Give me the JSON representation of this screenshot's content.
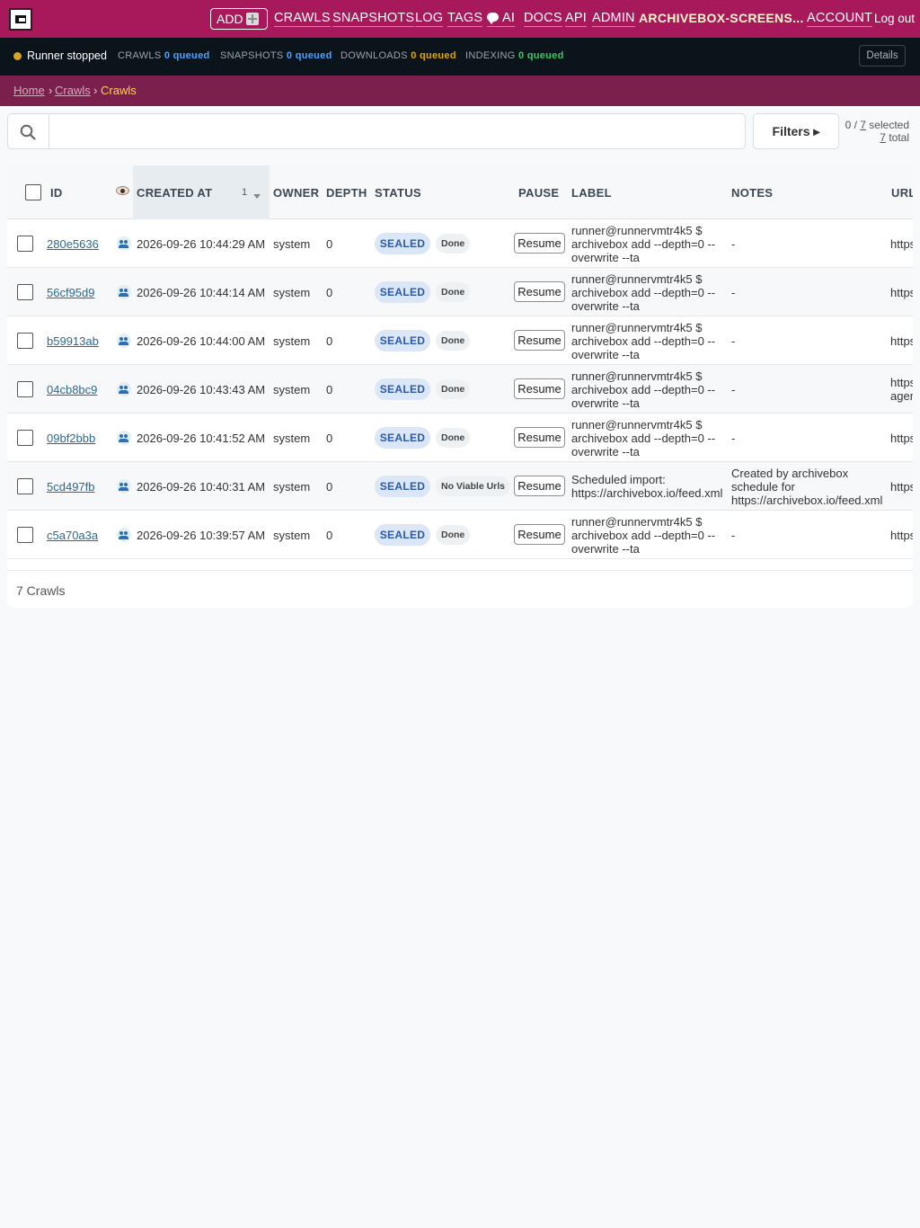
{
  "nav": {
    "add_label": "ADD",
    "items": [
      "CRAWLS",
      "SNAPSHOTS",
      "LOG",
      "TAGS",
      "AI",
      "DOCS",
      "API",
      "ADMIN"
    ],
    "site_name": "ARCHIVEBOX-SCREENS...",
    "account": "ACCOUNT",
    "logout": "Log out"
  },
  "status": {
    "runner": "Runner stopped",
    "runner_color": "#d7a420",
    "crawls_label": "CRAWLS",
    "crawls_value": "0 queued",
    "snapshots_label": "SNAPSHOTS",
    "snapshots_value": "0 queued",
    "downloads_label": "DOWNLOADS",
    "downloads_value": "0 queued",
    "indexing_label": "INDEXING",
    "indexing_value": "0 queued",
    "details": "Details"
  },
  "breadcrumb": {
    "home": "Home",
    "sep1": "›",
    "crawls": "Crawls",
    "sep2": "›",
    "current": "Crawls"
  },
  "search": {
    "value": "",
    "placeholder": ""
  },
  "filters_label": "Filters ▸",
  "selection": {
    "selected": "0",
    "sep": " / ",
    "total_link": "7",
    "selected_word": " selected",
    "total": "7",
    "total_word": " total"
  },
  "table": {
    "headers": {
      "id": "ID",
      "created_at": "CREATED AT",
      "sort_index": "1",
      "owner": "OWNER",
      "depth": "DEPTH",
      "status": "STATUS",
      "pause": "PAUSE",
      "label": "LABEL",
      "notes": "NOTES",
      "urls": "URL"
    },
    "rows": [
      {
        "id": "280e5636",
        "created": "2026-09-26 10:44:29 AM",
        "owner": "system",
        "depth": "0",
        "status": "SEALED",
        "state": "Done",
        "pause": "Resume",
        "label": "runner@runnervmtr4k5 $ archivebox add --depth=0 --overwrite --ta",
        "notes": "-",
        "urls": "https"
      },
      {
        "id": "56cf95d9",
        "created": "2026-09-26 10:44:14 AM",
        "owner": "system",
        "depth": "0",
        "status": "SEALED",
        "state": "Done",
        "pause": "Resume",
        "label": "runner@runnervmtr4k5 $ archivebox add --depth=0 --overwrite --ta",
        "notes": "-",
        "urls": "https"
      },
      {
        "id": "b59913ab",
        "created": "2026-09-26 10:44:00 AM",
        "owner": "system",
        "depth": "0",
        "status": "SEALED",
        "state": "Done",
        "pause": "Resume",
        "label": "runner@runnervmtr4k5 $ archivebox add --depth=0 --overwrite --ta",
        "notes": "-",
        "urls": "https"
      },
      {
        "id": "04cb8bc9",
        "created": "2026-09-26 10:43:43 AM",
        "owner": "system",
        "depth": "0",
        "status": "SEALED",
        "state": "Done",
        "pause": "Resume",
        "label": "runner@runnervmtr4k5 $ archivebox add --depth=0 --overwrite --ta",
        "notes": "-",
        "urls": "https agen"
      },
      {
        "id": "09bf2bbb",
        "created": "2026-09-26 10:41:52 AM",
        "owner": "system",
        "depth": "0",
        "status": "SEALED",
        "state": "Done",
        "pause": "Resume",
        "label": "runner@runnervmtr4k5 $ archivebox add --depth=0 --overwrite --ta",
        "notes": "-",
        "urls": "https"
      },
      {
        "id": "5cd497fb",
        "created": "2026-09-26 10:40:31 AM",
        "owner": "system",
        "depth": "0",
        "status": "SEALED",
        "state": "No Viable Urls",
        "pause": "Resume",
        "label": "Scheduled import: https://archivebox.io/feed.xml",
        "notes": "Created by archivebox schedule for https://archivebox.io/feed.xml",
        "urls": "https"
      },
      {
        "id": "c5a70a3a",
        "created": "2026-09-26 10:39:57 AM",
        "owner": "system",
        "depth": "0",
        "status": "SEALED",
        "state": "Done",
        "pause": "Resume",
        "label": "runner@runnervmtr4k5 $ archivebox add --depth=0 --overwrite --ta",
        "notes": "-",
        "urls": "https"
      }
    ],
    "footer": "7 Crawls"
  }
}
